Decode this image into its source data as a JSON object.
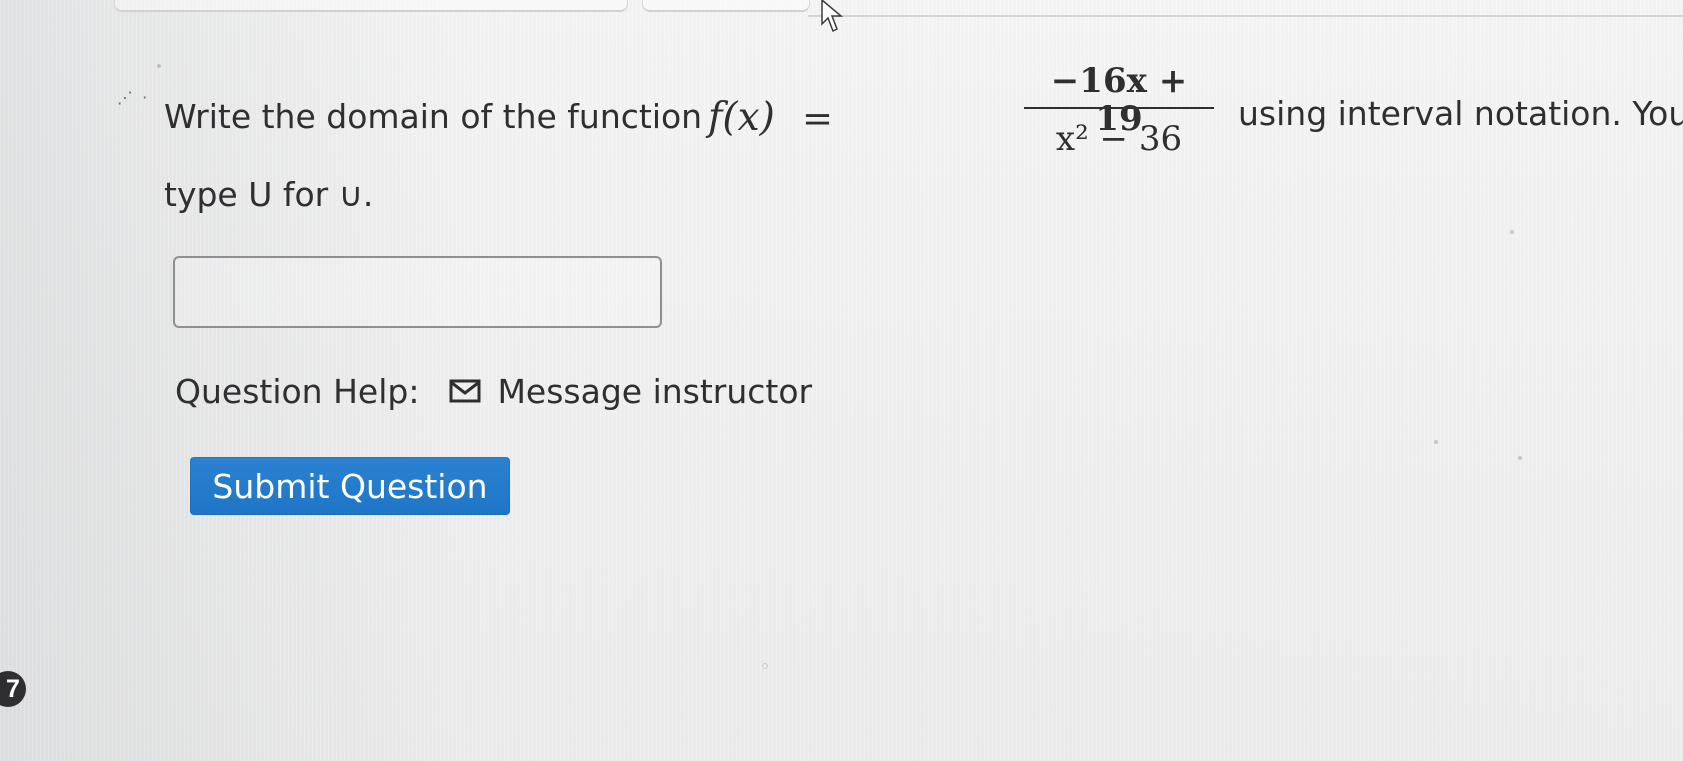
{
  "question": {
    "prefix": "Write the domain of the function",
    "function_lhs": "f(x)",
    "equals": "=",
    "numerator": "−16x + 19",
    "denominator": "x² − 36",
    "suffix": "using interval notation. You can",
    "second_line": "type U for ∪."
  },
  "answer_input": {
    "value": "",
    "placeholder": ""
  },
  "help": {
    "label": "Question Help:",
    "message_link": "Message instructor",
    "icon": "mail-icon"
  },
  "actions": {
    "submit_label": "Submit Question"
  },
  "page_marker": {
    "number": "7"
  },
  "colors": {
    "text": "#2f2f31",
    "submit_button": "#1f75c6",
    "background": "#eeeeee"
  }
}
